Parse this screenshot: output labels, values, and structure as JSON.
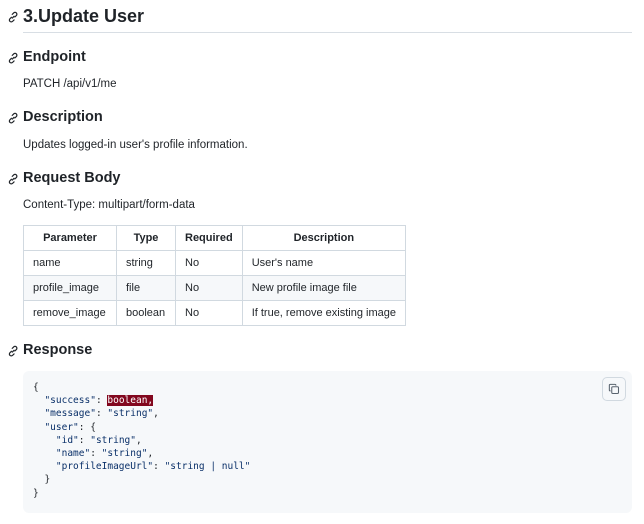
{
  "title": "3.Update User",
  "endpoint": {
    "heading": "Endpoint",
    "text": "PATCH /api/v1/me"
  },
  "description": {
    "heading": "Description",
    "text": "Updates logged-in user's profile information."
  },
  "request_body": {
    "heading": "Request Body",
    "content_type": "Content-Type: multipart/form-data",
    "table": {
      "headers": [
        "Parameter",
        "Type",
        "Required",
        "Description"
      ],
      "rows": [
        [
          "name",
          "string",
          "No",
          "User's name"
        ],
        [
          "profile_image",
          "file",
          "No",
          "New profile image file"
        ],
        [
          "remove_image",
          "boolean",
          "No",
          "If true, remove existing image"
        ]
      ]
    }
  },
  "response": {
    "heading": "Response",
    "code": {
      "l1": "{",
      "success_key": "\"success\"",
      "success_val": "boolean,",
      "message_key": "\"message\"",
      "message_val": "\"string\"",
      "user_key": "\"user\"",
      "id_key": "\"id\"",
      "id_val": "\"string\"",
      "name_key": "\"name\"",
      "name_val": "\"string\"",
      "pimg_key": "\"profileImageUrl\"",
      "pimg_val": "\"string | null\"",
      "l9": "}",
      "l10": "}"
    }
  },
  "icons": {
    "heading_link": "link-icon",
    "copy": "copy-icon"
  },
  "colors": {
    "text": "#1f2328",
    "code_bg": "#f6f8fa",
    "border": "#d1d9e0",
    "error_highlight": "#82071e"
  }
}
